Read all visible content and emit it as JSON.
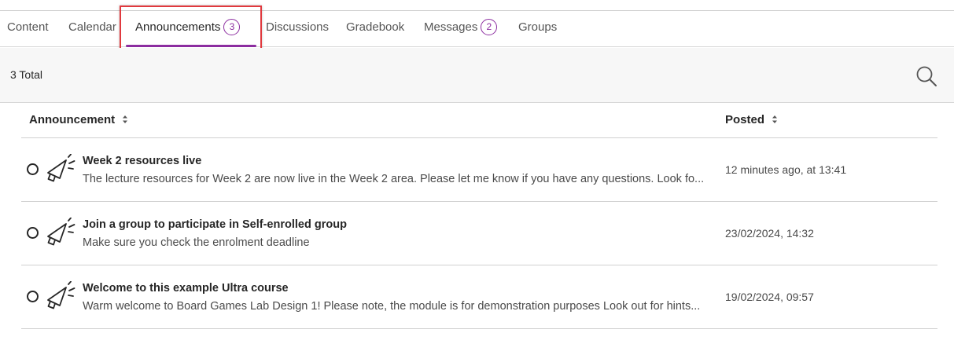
{
  "tabs": [
    {
      "label": "Content"
    },
    {
      "label": "Calendar"
    },
    {
      "label": "Announcements",
      "badge": "3",
      "active": true
    },
    {
      "label": "Discussions"
    },
    {
      "label": "Gradebook"
    },
    {
      "label": "Messages",
      "badge": "2"
    },
    {
      "label": "Groups"
    }
  ],
  "toolbar": {
    "total": "3 Total",
    "search_icon": "search-icon"
  },
  "table": {
    "columns": {
      "announcement": "Announcement",
      "posted": "Posted"
    },
    "rows": [
      {
        "title": "Week 2 resources live",
        "summary": "The lecture resources for Week 2 are now live in the Week 2 area. Please let me know if you have any questions.  Look fo...",
        "posted": "12 minutes ago, at 13:41"
      },
      {
        "title": "Join a group to participate in Self-enrolled group",
        "summary": "Make sure you check the enrolment deadline",
        "posted": "23/02/2024, 14:32"
      },
      {
        "title": "Welcome to this example Ultra course",
        "summary": "Warm welcome to Board Games Lab Design 1! Please note, the module is for demonstration purposes Look out for hints...",
        "posted": "19/02/2024, 09:57"
      }
    ]
  },
  "colors": {
    "accent": "#8c2da0",
    "highlight_box": "#e0393e"
  }
}
